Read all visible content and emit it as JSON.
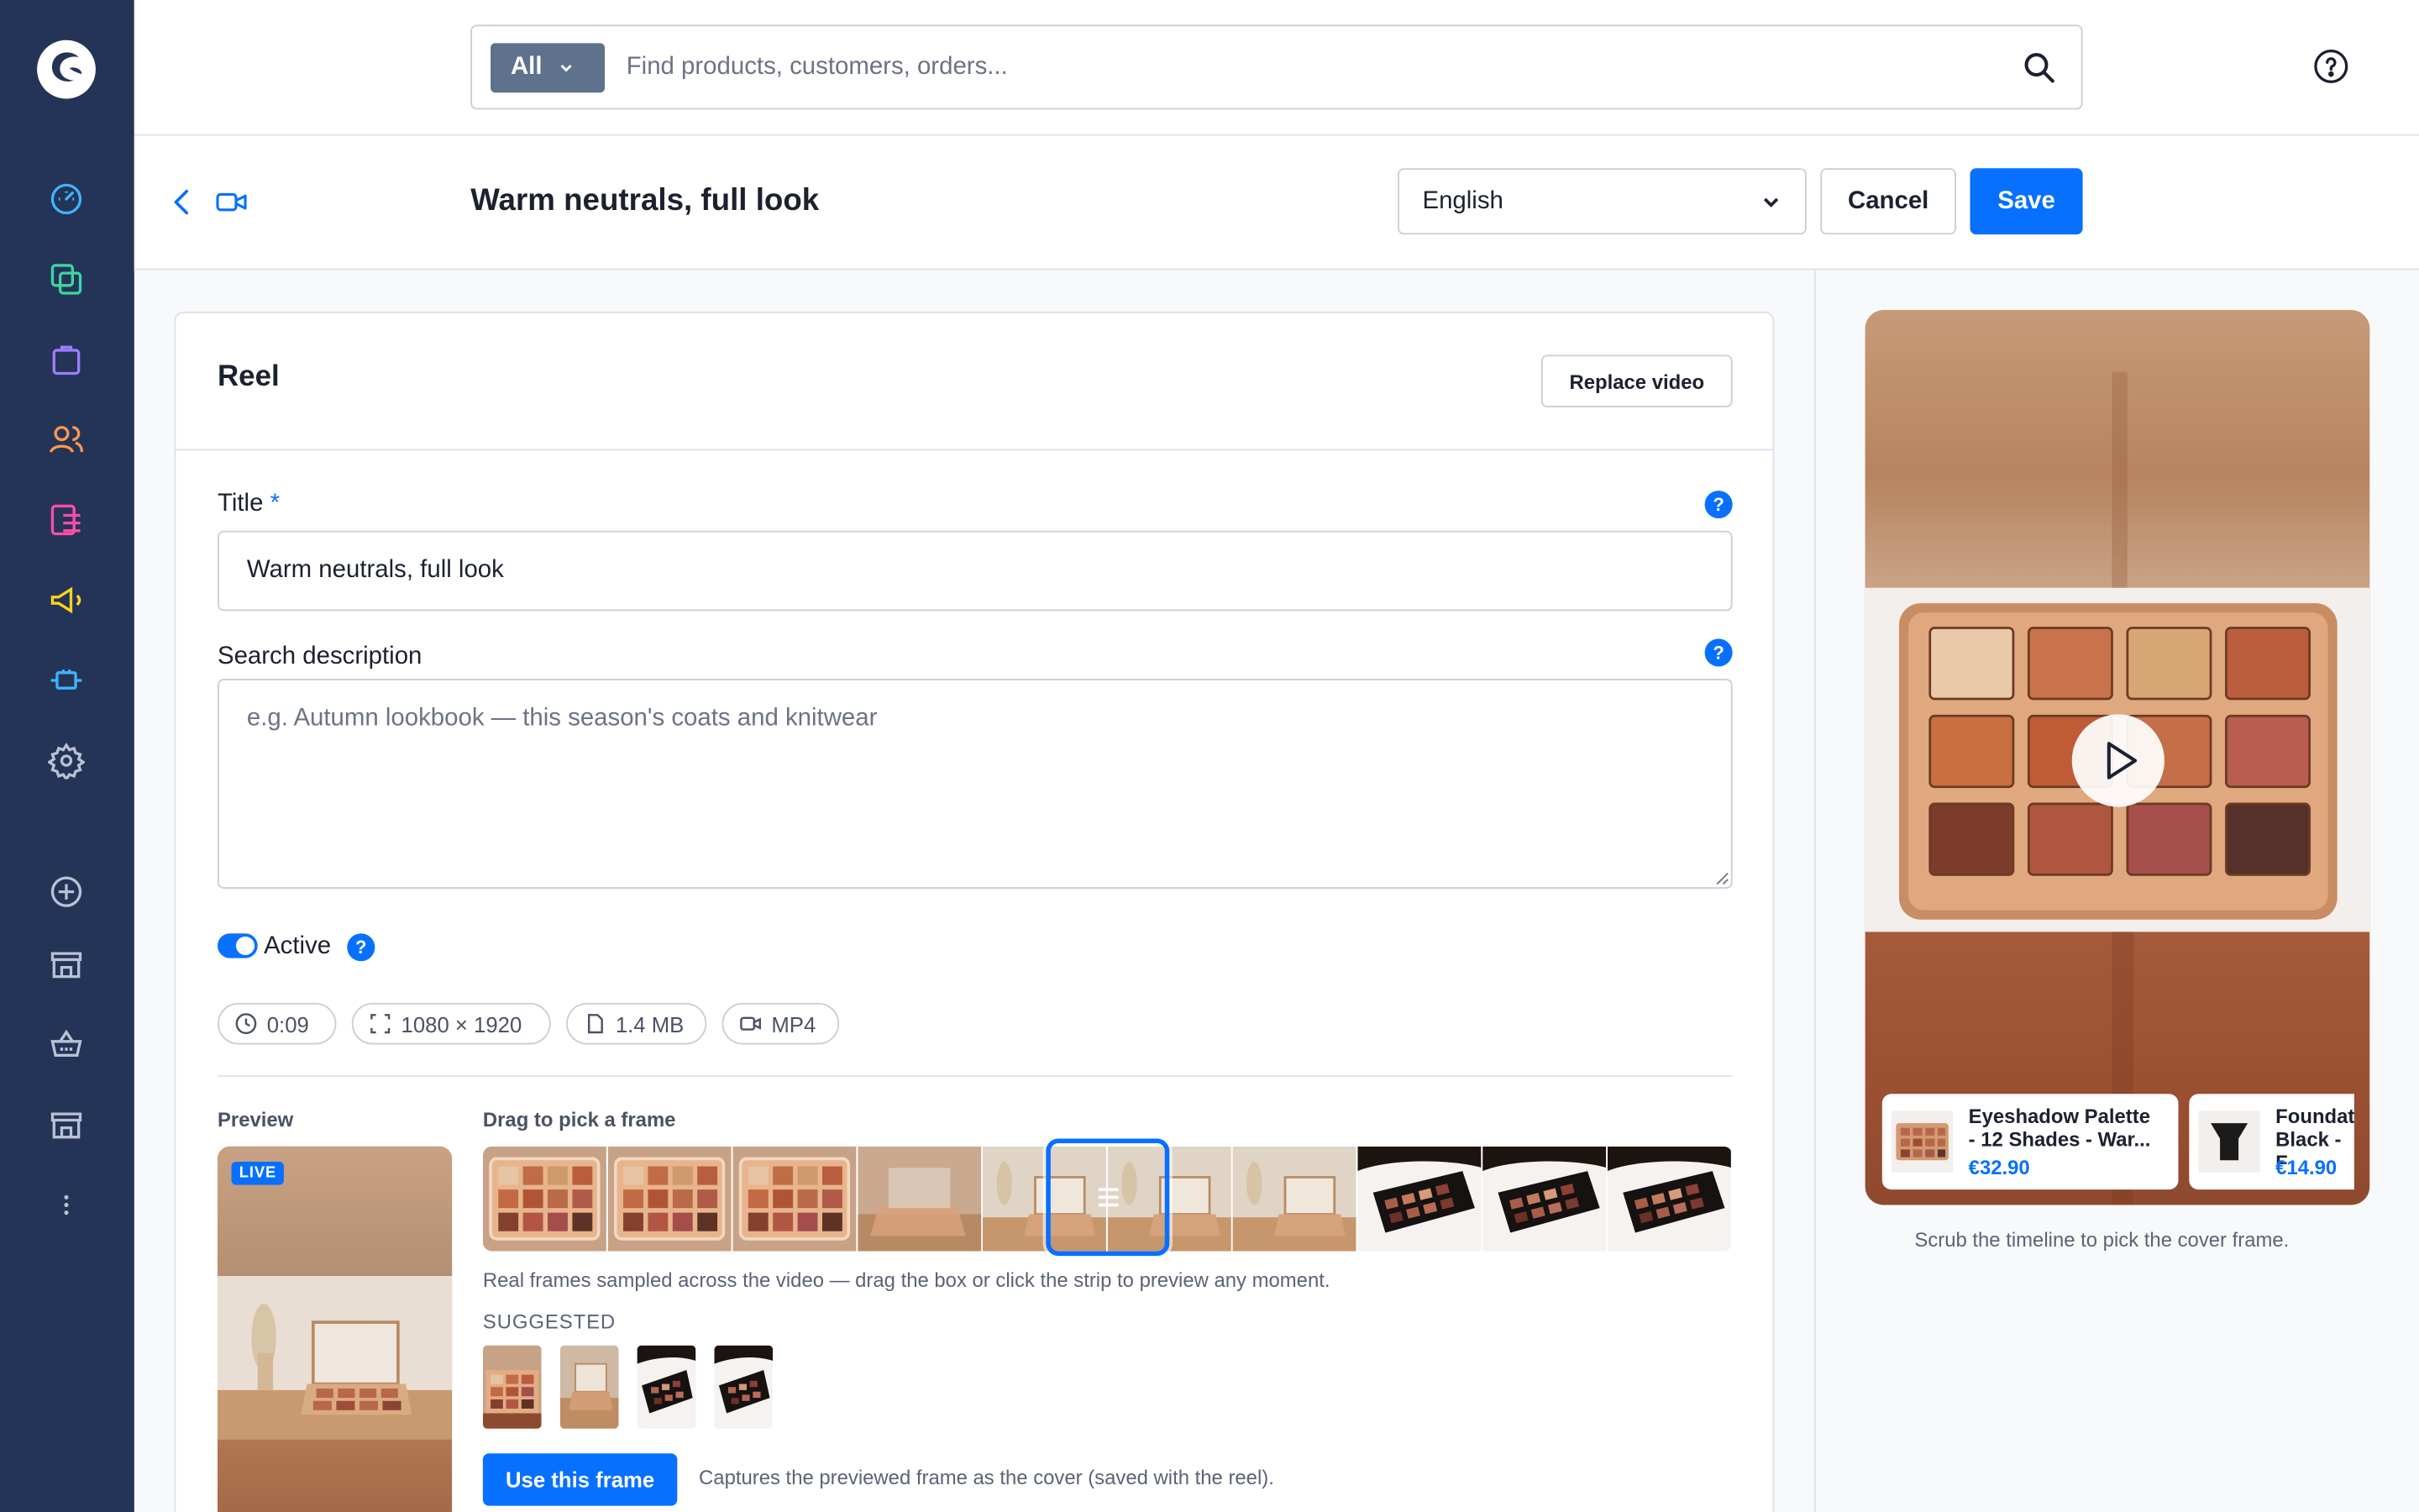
{
  "app": {
    "brand_color": "#243457",
    "accent_color": "#0870ff"
  },
  "topbar": {
    "search_scope": "All",
    "search_placeholder": "Find products, customers, orders..."
  },
  "header": {
    "title": "Warm neutrals, full look",
    "language": "English",
    "cancel_label": "Cancel",
    "save_label": "Save"
  },
  "card": {
    "title": "Reel",
    "replace_label": "Replace video",
    "title_label": "Title",
    "required_mark": "*",
    "title_value": "Warm neutrals, full look",
    "description_label": "Search description",
    "description_placeholder": "e.g. Autumn lookbook — this season's coats and knitwear",
    "active_label": "Active",
    "active": true,
    "help_glyph": "?",
    "meta": {
      "duration": "0:09",
      "resolution": "1080 × 1920",
      "size": "1.4 MB",
      "format": "MP4"
    },
    "preview_label": "Preview",
    "live_badge": "LIVE",
    "strip_label": "Drag to pick a frame",
    "strip_help": "Real frames sampled across the video — drag the box or click the strip to preview any moment.",
    "suggested_label": "SUGGESTED",
    "use_frame_label": "Use this frame",
    "use_frame_help": "Captures the previewed frame as the cover (saved with the reel)."
  },
  "phone_preview": {
    "products": [
      {
        "name_line1": "Eyeshadow Palette",
        "name_line2": "- 12 Shades - War...",
        "price": "€32.90"
      },
      {
        "name_line1": "Foundat",
        "name_line2": "Black - F",
        "price": "€14.90"
      }
    ],
    "scrub_help": "Scrub the timeline to pick the cover frame."
  }
}
